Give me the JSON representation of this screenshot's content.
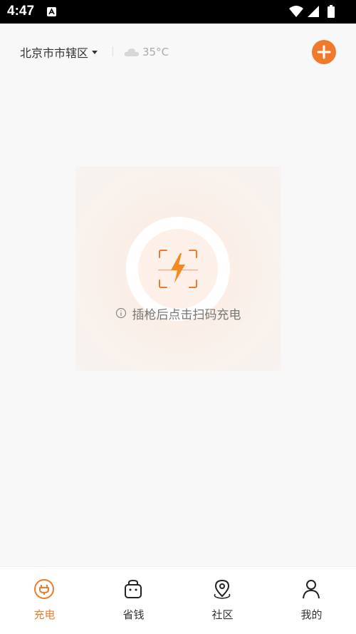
{
  "status_bar": {
    "time": "4:47"
  },
  "header": {
    "location": "北京市市辖区",
    "weather_temp": "35°C",
    "accent_color": "#f07a2c"
  },
  "scan": {
    "hint": "插枪后点击扫码充电"
  },
  "tabs": [
    {
      "label": "充电",
      "icon": "charge-plug-icon",
      "active": true
    },
    {
      "label": "省钱",
      "icon": "wallet-icon",
      "active": false
    },
    {
      "label": "社区",
      "icon": "location-pin-icon",
      "active": false
    },
    {
      "label": "我的",
      "icon": "user-icon",
      "active": false
    }
  ]
}
